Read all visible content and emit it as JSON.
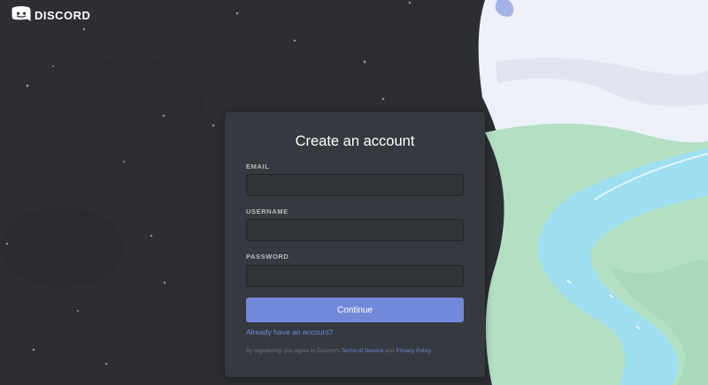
{
  "brand": {
    "name": "DISCORD"
  },
  "form": {
    "title": "Create an account",
    "email_label": "EMAIL",
    "email_value": "",
    "username_label": "USERNAME",
    "username_value": "",
    "password_label": "PASSWORD",
    "password_value": "",
    "continue_label": "Continue",
    "login_link": "Already have an account?",
    "terms_prefix": "By registering, you agree to Discord's ",
    "terms_of_service": "Terms of Service",
    "terms_and": " and ",
    "privacy_policy": "Privacy Policy",
    "terms_suffix": "."
  },
  "colors": {
    "background": "#2c2e33",
    "card": "#36393f",
    "input": "#303338",
    "accent": "#7289da",
    "sky": "#eef1fa",
    "grass": "#b3dfc3",
    "river": "#9ddff0"
  }
}
